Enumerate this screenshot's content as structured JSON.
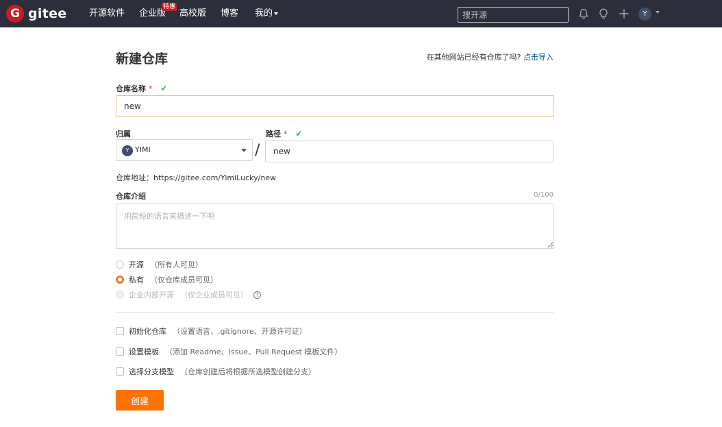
{
  "topbar": {
    "logo_mark": "G",
    "logo_text": "gitee",
    "nav": [
      "开源软件",
      "企业版",
      "高校版",
      "博客",
      "我的"
    ],
    "enterprise_badge": "特惠",
    "search_placeholder": "搜开源",
    "avatar_letter": "Y",
    "icons": [
      "bell-icon",
      "lightbulb-icon",
      "plus-icon"
    ]
  },
  "page": {
    "title": "新建仓库",
    "import_prompt": "在其他网站已经有仓库了吗?",
    "import_link": "点击导入"
  },
  "form": {
    "name_label": "仓库名称",
    "name_value": "new",
    "required_mark": "*",
    "check_mark": "✔",
    "owner_label": "归属",
    "owner_letter": "Y",
    "owner_name": "YIMI",
    "separator": "/",
    "path_label": "路径",
    "path_value": "new",
    "address_text": "仓库地址：https://gitee.com/YimiLucky/new",
    "desc_label": "仓库介绍",
    "desc_counter": "0/100",
    "desc_placeholder": "用简短的语言来描述一下吧",
    "visibility": [
      {
        "label": "开源",
        "desc": "（所有人可见）",
        "selected": false,
        "disabled": false
      },
      {
        "label": "私有",
        "desc": "（仅仓库成员可见）",
        "selected": true,
        "disabled": false
      },
      {
        "label": "企业内部开源",
        "desc": "（仅企业成员可见）",
        "selected": false,
        "disabled": true
      }
    ],
    "help_mark": "?",
    "options": [
      {
        "label": "初始化仓库",
        "desc": "（设置语言、.gitignore、开源许可证）"
      },
      {
        "label": "设置模板",
        "desc": "（添加 Readme、Issue、Pull Request 模板文件）"
      },
      {
        "label": "选择分支模型",
        "desc": "（仓库创建后将根据所选模型创建分支）"
      }
    ],
    "submit_label": "创建"
  },
  "colors": {
    "topbar_bg": "#2c2f3b",
    "brand_red": "#c71d23",
    "accent_orange": "#fe7300",
    "check_green": "#21ba45",
    "link": "#005980"
  }
}
